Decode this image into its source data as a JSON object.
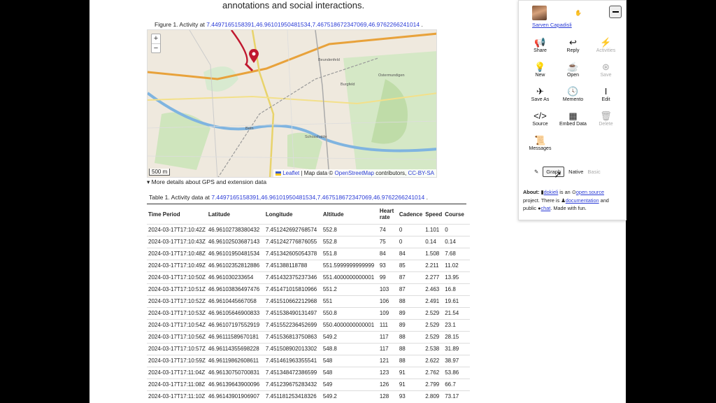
{
  "article": {
    "intro_text": "annotations and social interactions.",
    "figure_caption_prefix": "Figure 1. Activity at",
    "figure_caption_link": "7.4497165158391,46.96101950481534,7.467518672347069,46.9762266241014",
    "figure_caption_suffix": ".",
    "details_summary": "▾ More details about GPS and extension data",
    "table_caption_prefix": "Table 1. Activity data at",
    "table_caption_link": "7.4497165158391,46.96101950481534,7.467518672347069,46.9762266241014",
    "table_caption_suffix": "."
  },
  "map": {
    "zoom_in": "+",
    "zoom_out": "−",
    "scale": "500 m",
    "attribution_leaflet": "Leaflet",
    "attribution_sep": "| Map data ©",
    "attribution_osm": "OpenStreetMap",
    "attribution_contrib": "contributors,",
    "attribution_license": "CC-BY-SA",
    "labels": [
      "Bern",
      "Ostermundigen",
      "Beundenfeld",
      "Burgfeld",
      "Schosshalde"
    ],
    "colors": {
      "track": "#c0182f",
      "rail": "#d94b4b",
      "green": "#bfdca8"
    }
  },
  "table": {
    "headers": [
      "Time Period",
      "Latitude",
      "Longitude",
      "Altitude",
      "Heart rate",
      "Cadence",
      "Speed",
      "Course"
    ],
    "rows": [
      [
        "2024-03-17T17:10:42Z",
        "46.96102738380432",
        "7.451242692768574",
        "552.8",
        "74",
        "0",
        "1.101",
        "0"
      ],
      [
        "2024-03-17T17:10:43Z",
        "46.96102503687143",
        "7.451242776876055",
        "552.8",
        "75",
        "0",
        "0.14",
        "0.14"
      ],
      [
        "2024-03-17T17:10:48Z",
        "46.96101950481534",
        "7.451342605054378",
        "551.8",
        "84",
        "84",
        "1.508",
        "7.68"
      ],
      [
        "2024-03-17T17:10:49Z",
        "46.96102352812886",
        "7.451388118788",
        "551.5999999999999",
        "93",
        "85",
        "2.211",
        "11.02"
      ],
      [
        "2024-03-17T17:10:50Z",
        "46.961030233654",
        "7.451432375237346",
        "551.4000000000001",
        "99",
        "87",
        "2.277",
        "13.95"
      ],
      [
        "2024-03-17T17:10:51Z",
        "46.96103836497476",
        "7.451471015810966",
        "551.2",
        "103",
        "87",
        "2.463",
        "16.8"
      ],
      [
        "2024-03-17T17:10:52Z",
        "46.9610445667058",
        "7.451510662212968",
        "551",
        "106",
        "88",
        "2.491",
        "19.61"
      ],
      [
        "2024-03-17T17:10:53Z",
        "46.96105646900833",
        "7.451538490131497",
        "550.8",
        "109",
        "89",
        "2.529",
        "21.54"
      ],
      [
        "2024-03-17T17:10:54Z",
        "46.96107197552919",
        "7.451552236452699",
        "550.4000000000001",
        "111",
        "89",
        "2.529",
        "23.1"
      ],
      [
        "2024-03-17T17:10:56Z",
        "46.96111589670181",
        "7.451536813750863",
        "549.2",
        "117",
        "88",
        "2.529",
        "28.15"
      ],
      [
        "2024-03-17T17:10:57Z",
        "46.96114355698228",
        "7.451508902013302",
        "548.8",
        "117",
        "88",
        "2.538",
        "31.89"
      ],
      [
        "2024-03-17T17:10:59Z",
        "46.96119862608611",
        "7.451461963355541",
        "548",
        "121",
        "88",
        "2.622",
        "38.97"
      ],
      [
        "2024-03-17T17:11:04Z",
        "46.96130750700831",
        "7.451348472386599",
        "548",
        "123",
        "91",
        "2.762",
        "53.86"
      ],
      [
        "2024-03-17T17:11:08Z",
        "46.96139643900096",
        "7.451239675283432",
        "549",
        "126",
        "91",
        "2.799",
        "66.7"
      ],
      [
        "2024-03-17T17:11:10Z",
        "46.96143901906907",
        "7.451181253418326",
        "549.2",
        "128",
        "93",
        "2.809",
        "73.17"
      ]
    ]
  },
  "panel": {
    "user_name": "Sarven Capadisli",
    "actions": [
      {
        "label": "Share",
        "icon": "megaphone-icon",
        "glyph": "📢",
        "enabled": true
      },
      {
        "label": "Reply",
        "icon": "reply-icon",
        "glyph": "↩",
        "enabled": true
      },
      {
        "label": "Activities",
        "icon": "bolt-icon",
        "glyph": "⚡",
        "enabled": false
      },
      {
        "label": "New",
        "icon": "lightbulb-icon",
        "glyph": "💡",
        "enabled": true
      },
      {
        "label": "Open",
        "icon": "coffee-icon",
        "glyph": "☕",
        "enabled": true
      },
      {
        "label": "Save",
        "icon": "life-ring-icon",
        "glyph": "⊛",
        "enabled": false
      },
      {
        "label": "Save As",
        "icon": "paper-plane-icon",
        "glyph": "✈",
        "enabled": true
      },
      {
        "label": "Memento",
        "icon": "clock-icon",
        "glyph": "🕓",
        "enabled": true
      },
      {
        "label": "Edit",
        "icon": "text-cursor-icon",
        "glyph": "Ι",
        "enabled": true
      },
      {
        "label": "Source",
        "icon": "code-icon",
        "glyph": "</>",
        "enabled": true
      },
      {
        "label": "Embed Data",
        "icon": "table-icon",
        "glyph": "▦",
        "enabled": true
      },
      {
        "label": "Delete",
        "icon": "trash-icon",
        "glyph": "🗑",
        "enabled": false
      },
      {
        "label": "Messages",
        "icon": "scroll-icon",
        "glyph": "📜",
        "enabled": true
      }
    ],
    "modes": {
      "graph": "Graph",
      "native": "Native",
      "basic": "Basic"
    },
    "about": {
      "label": "About:",
      "dokieli": "dokieli",
      "is_an": "is an",
      "open_source": "open source",
      "project_there_is": "project. There is",
      "documentation": "documentation",
      "and_public": "and public",
      "chat": "chat",
      "made_with": ". Made with fun."
    }
  }
}
